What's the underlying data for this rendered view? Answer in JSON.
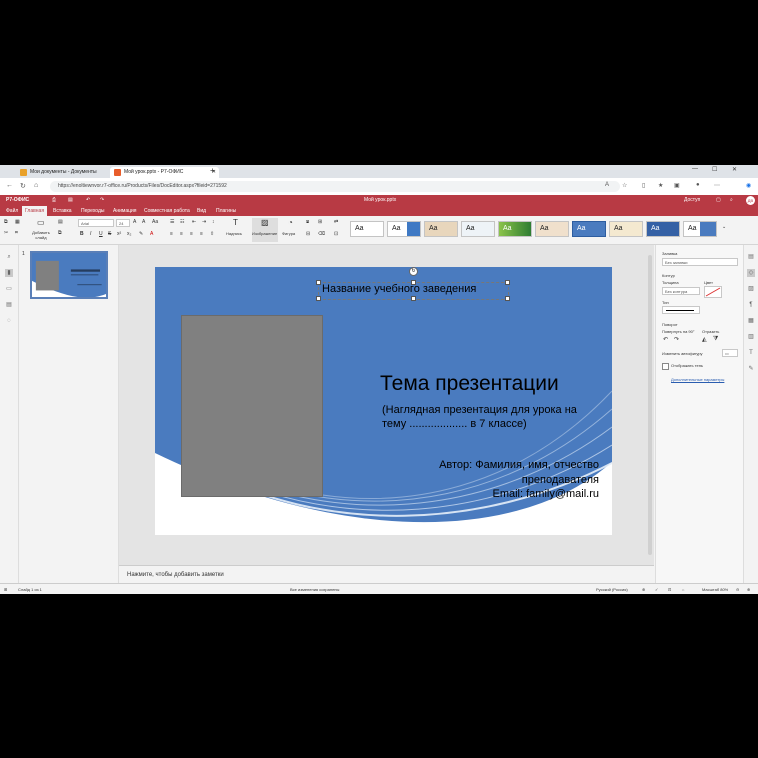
{
  "browser": {
    "tabs": [
      {
        "title": "Мои документы - Документы",
        "active": false,
        "color": "#e9a12a"
      },
      {
        "title": "Мой урок.pptx - Р7-ОФИС",
        "active": true,
        "color": "#e85d2b"
      }
    ],
    "new_tab": "+",
    "url": "https://enoltiewnvor.r7-office.ru/Products/Files/DocEditor.aspx?fileid=271592"
  },
  "app": {
    "logo": "Р7-ОФИС",
    "doc_title": "Мой урок.pptx",
    "user": "Доступ"
  },
  "menu": [
    "Файл",
    "Главная",
    "Вставка",
    "Переходы",
    "Анимация",
    "Совместная работа",
    "Вид",
    "Плагины"
  ],
  "menu_active_index": 1,
  "ribbon": {
    "add_slide": "Добавить слайд",
    "font_name": "Arial",
    "font_size": "24",
    "caption_label": "Надпись",
    "image_label": "Изображение",
    "shape_label": "Фигура",
    "theme_sample": "Aa"
  },
  "slide": {
    "institution": "Название учебного заведения",
    "title": "Тема презентации",
    "subtitle_line1": "(Наглядная презентация для урока на",
    "subtitle_line2": "тему ................... в 7 классе)",
    "author_line1": "Автор: Фамилия, имя, отчество",
    "author_line2": "преподавателя",
    "author_line3": "Email: family@mail.ru"
  },
  "thumbnail": {
    "number": "1"
  },
  "notes_placeholder": "Нажмите, чтобы добавить заметки",
  "right_panel": {
    "fill_label": "Заливка",
    "fill_value": "Без заливки",
    "stroke_label": "Контур",
    "thickness_label": "Толщина",
    "thickness_value": "Без контура",
    "color_label": "Цвет",
    "type_label": "Тип",
    "rotation_label": "Поворот",
    "rotate90_label": "Повернуть на 90°",
    "flip_label": "Отразить",
    "change_shape_label": "Изменить автофигуру",
    "shadow_label": "Отображать тень",
    "advanced_label": "Дополнительные параметры"
  },
  "status": {
    "slide_of": "Слайд 1 из 1",
    "saved": "Все изменения сохранены",
    "language": "Русский (Россия)",
    "zoom": "Масштаб 80%"
  },
  "colors": {
    "brand": "#b83a44",
    "slide_blue": "#4a7bbf",
    "placeholder_gray": "#808080"
  }
}
